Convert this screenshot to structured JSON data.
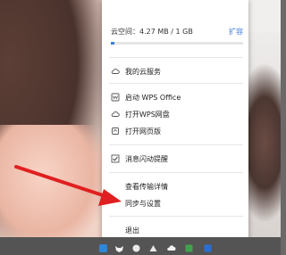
{
  "storage": {
    "label": "云空间：4.27 MB / 1 GB",
    "expand": "扩容",
    "used_fraction": 0.004
  },
  "menu": {
    "my_cloud": "我的云服务",
    "launch_wps": "启动 WPS Office",
    "open_wps_cloud": "打开WPS网盘",
    "open_web": "打开网页版",
    "message_flash": "消息闪动提醒",
    "view_transfer": "查看传输详情",
    "sync_settings": "同步与设置",
    "exit": "退出"
  },
  "colors": {
    "accent": "#3b7ddd",
    "arrow": "#e02020"
  },
  "icons": [
    "cloud-icon",
    "wps-icon",
    "cloud-outline-icon",
    "browser-icon",
    "checkbox-checked-icon"
  ]
}
